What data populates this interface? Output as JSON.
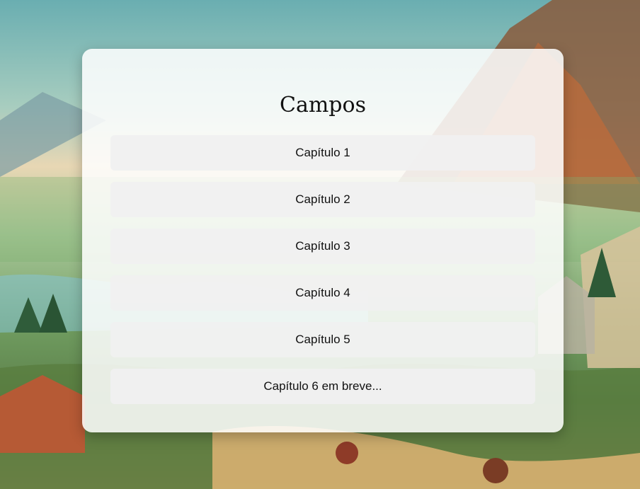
{
  "page": {
    "title": "Campos"
  },
  "chapters": [
    {
      "label": "Capítulo 1"
    },
    {
      "label": "Capítulo 2"
    },
    {
      "label": "Capítulo 3"
    },
    {
      "label": "Capítulo 4"
    },
    {
      "label": "Capítulo 5"
    },
    {
      "label": "Capítulo 6 em breve..."
    }
  ],
  "colors": {
    "card_background": "#ffffff",
    "chapter_background": "#f0f0f0",
    "text": "#111111"
  }
}
